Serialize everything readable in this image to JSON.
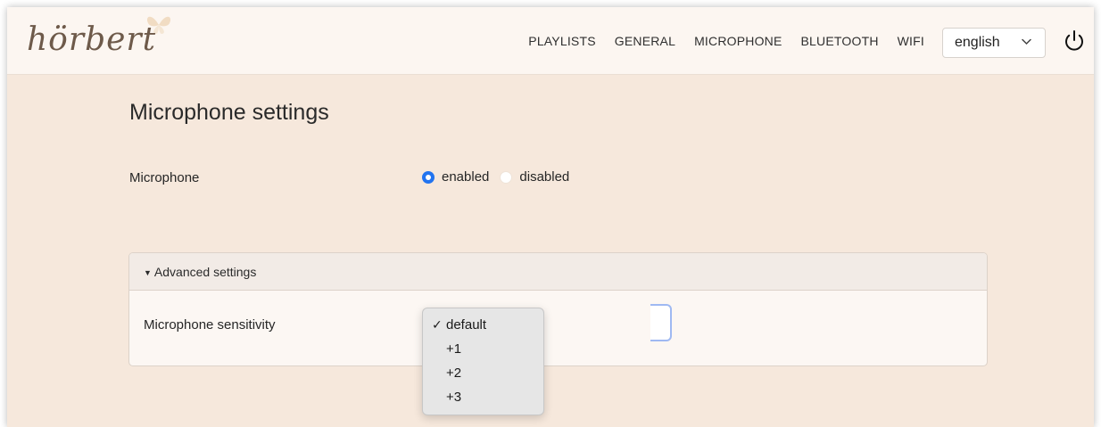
{
  "app": {
    "logo_text": "hörbert"
  },
  "nav": {
    "items": [
      {
        "label": "PLAYLISTS"
      },
      {
        "label": "GENERAL"
      },
      {
        "label": "MICROPHONE"
      },
      {
        "label": "BLUETOOTH"
      },
      {
        "label": "WIFI"
      }
    ],
    "language": {
      "selected": "english"
    },
    "power_icon": "power-icon"
  },
  "main": {
    "title": "Microphone settings",
    "microphone": {
      "label": "Microphone",
      "options": [
        {
          "label": "enabled",
          "checked": true
        },
        {
          "label": "disabled",
          "checked": false
        }
      ]
    },
    "advanced": {
      "header": "Advanced settings",
      "sensitivity": {
        "label": "Microphone sensitivity",
        "options": [
          {
            "label": "default",
            "selected": true
          },
          {
            "label": "+1",
            "selected": false
          },
          {
            "label": "+2",
            "selected": false
          },
          {
            "label": "+3",
            "selected": false
          }
        ]
      }
    }
  },
  "colors": {
    "background": "#f6e8dc",
    "navbar": "#fcf6f1",
    "accent": "#2274f0",
    "logo": "#6e5a4a"
  }
}
